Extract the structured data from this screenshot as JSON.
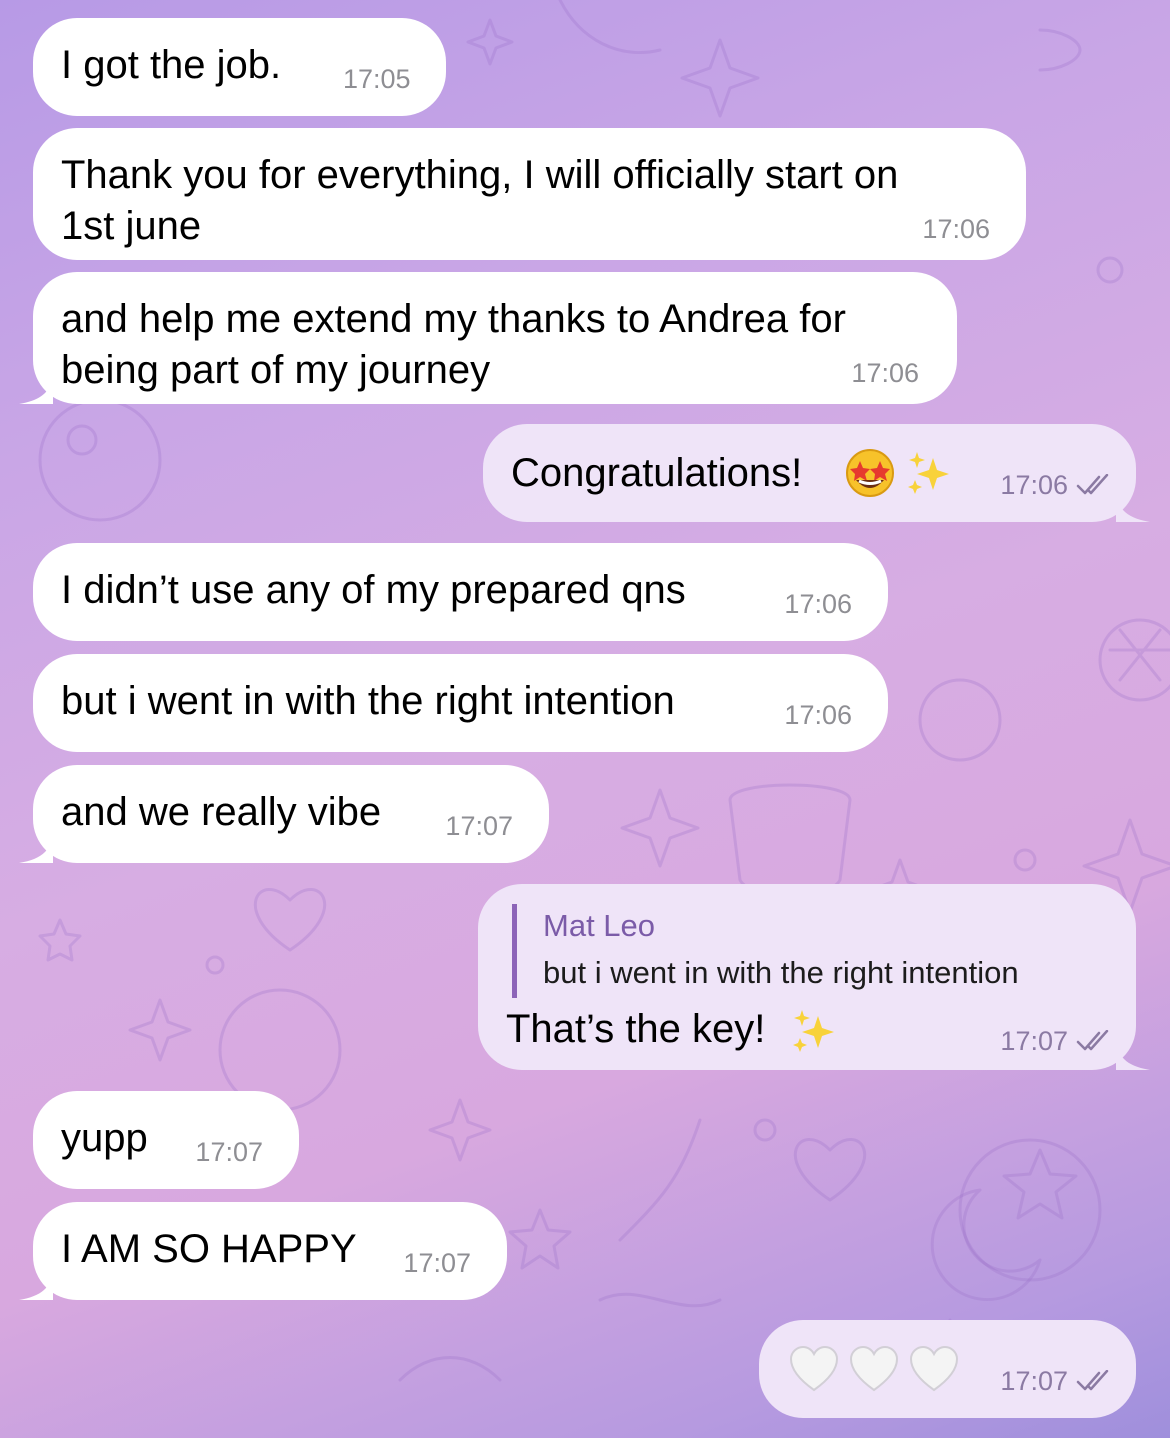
{
  "messages": [
    {
      "text": "I got the job.",
      "time": "17:05"
    },
    {
      "text": "Thank you for everything, I will officially start on",
      "text2": "1st june",
      "time": "17:06"
    },
    {
      "text": "and help me extend my thanks to Andrea for",
      "text2": "being part of my journey",
      "time": "17:06"
    },
    {
      "text": "Congratulations!",
      "time": "17:06"
    },
    {
      "text": "I didn’t use any of my prepared qns",
      "time": "17:06"
    },
    {
      "text": "but i went in with the right intention",
      "time": "17:06"
    },
    {
      "text": "and we really vibe",
      "time": "17:07"
    },
    {
      "reply_name": "Mat Leo",
      "reply_text": "but i went in with the right intention",
      "text": "That’s the key!",
      "time": "17:07"
    },
    {
      "text": "yupp",
      "time": "17:07"
    },
    {
      "text": "I AM SO HAPPY",
      "time": "17:07"
    },
    {
      "time": "17:07"
    }
  ],
  "icons": [
    "star-struck-emoji-icon",
    "sparkles-icon",
    "white-heart-icon",
    "read-receipt-icon"
  ],
  "colors": {
    "incoming": "#ffffff",
    "outgoing": "#efe4f8",
    "reply_accent": "#8c63b8"
  }
}
